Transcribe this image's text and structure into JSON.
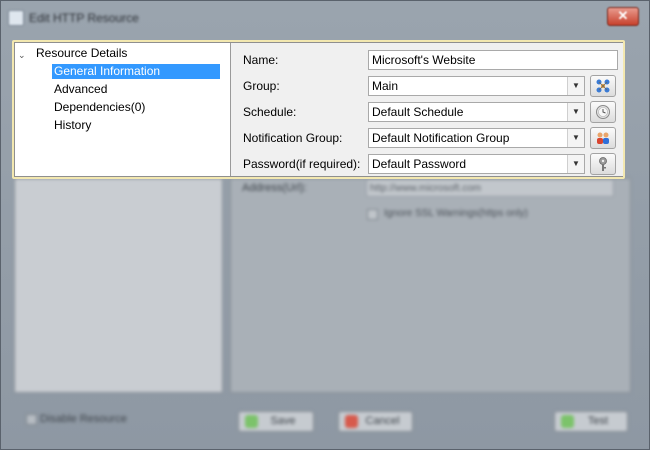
{
  "window": {
    "title": "Edit HTTP Resource",
    "close_glyph": "✕"
  },
  "tree": {
    "expand_glyph": "⌄",
    "root": "Resource Details",
    "items": [
      "General Information",
      "Advanced",
      "Dependencies(0)",
      "History"
    ]
  },
  "form": {
    "name_label": "Name:",
    "name_value": "Microsoft's Website",
    "group_label": "Group:",
    "group_value": "Main",
    "schedule_label": "Schedule:",
    "schedule_value": "Default Schedule",
    "notification_label": "Notification Group:",
    "notification_value": "Default Notification Group",
    "password_label": "Password(if required):",
    "password_value": "Default Password",
    "dropdown_glyph": "▼"
  },
  "background": {
    "address_label": "Address(Url):",
    "address_value": "http://www.microsoft.com",
    "ignore_ssl_label": "Ignore SSL Warnings(https only)",
    "disable_label": "Disable Resource"
  },
  "buttons": {
    "save": "Save",
    "cancel": "Cancel",
    "test": "Test"
  },
  "colors": {
    "selection": "#3399ff",
    "highlight": "#f3e8b0",
    "close": "#c8402c"
  },
  "icons": {
    "group": "group-network-icon",
    "schedule": "clock-icon",
    "notification": "users-icon",
    "password": "key-icon"
  }
}
